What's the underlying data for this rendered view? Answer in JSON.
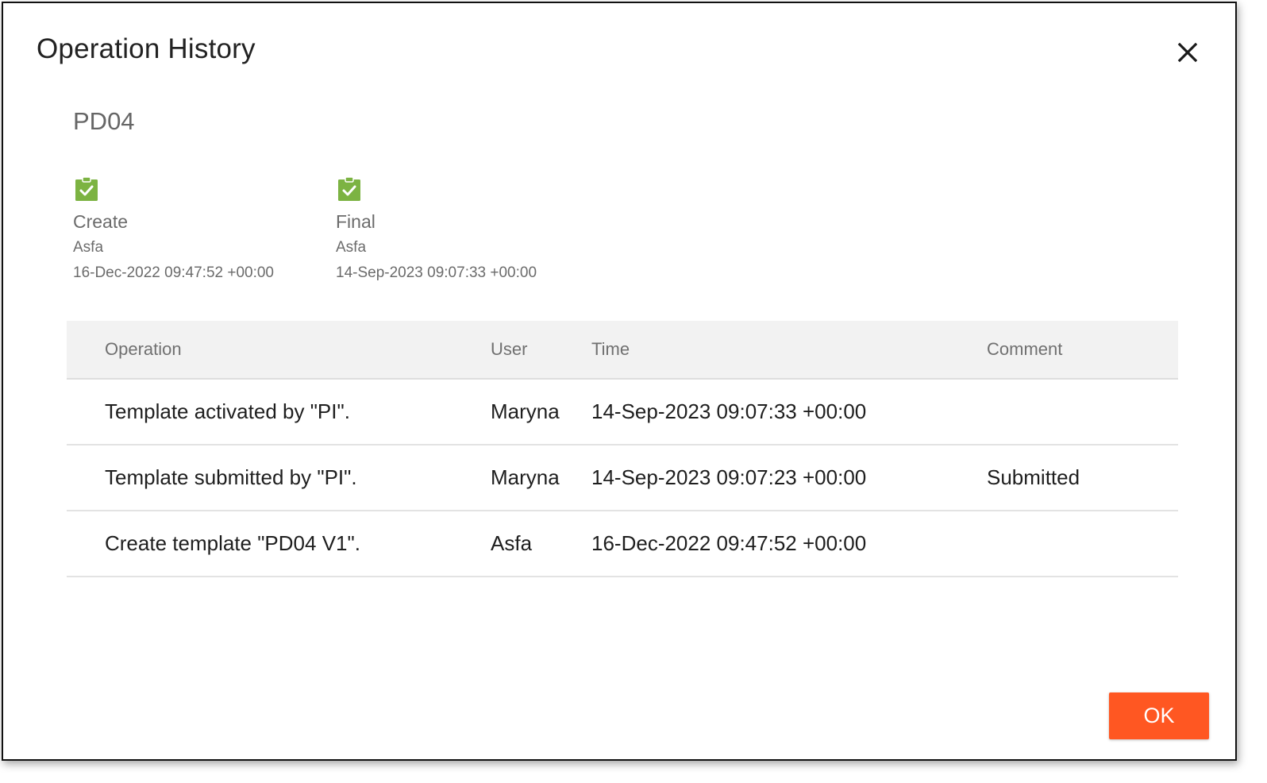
{
  "dialog": {
    "title": "Operation History",
    "close_icon": "close-icon"
  },
  "template": {
    "name": "PD04"
  },
  "steps": [
    {
      "icon": "clipboard-check-icon",
      "icon_color": "#7cb342",
      "label": "Create",
      "user": "Asfa",
      "time": "16-Dec-2022 09:47:52 +00:00"
    },
    {
      "icon": "clipboard-check-icon",
      "icon_color": "#7cb342",
      "label": "Final",
      "user": "Asfa",
      "time": "14-Sep-2023 09:07:33 +00:00"
    }
  ],
  "table": {
    "headers": {
      "operation": "Operation",
      "user": "User",
      "time": "Time",
      "comment": "Comment"
    },
    "rows": [
      {
        "operation": "Template activated by \"PI\".",
        "user": "Maryna",
        "time": "14-Sep-2023 09:07:33 +00:00",
        "comment": ""
      },
      {
        "operation": "Template submitted by \"PI\".",
        "user": "Maryna",
        "time": "14-Sep-2023 09:07:23 +00:00",
        "comment": "Submitted"
      },
      {
        "operation": "Create template \"PD04 V1\".",
        "user": "Asfa",
        "time": "16-Dec-2022 09:47:52 +00:00",
        "comment": ""
      }
    ]
  },
  "footer": {
    "ok_label": "OK",
    "ok_color": "#ff5722"
  }
}
